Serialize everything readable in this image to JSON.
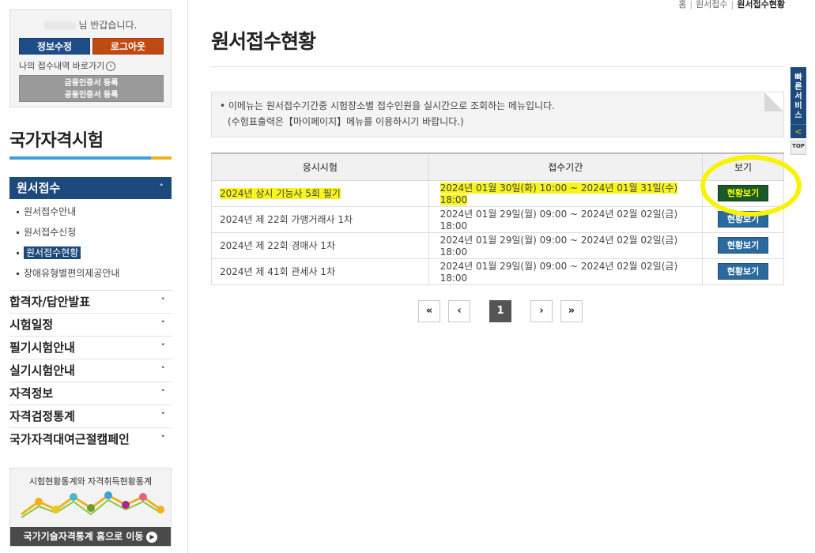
{
  "login": {
    "greeting_suffix": "님 반갑습니다.",
    "edit_button": "정보수정",
    "logout_button": "로그아웃",
    "my_link": "나의 접수내역 바로가기",
    "cert_line1": "금융인증서 등록",
    "cert_line2": "공동인증서 등록"
  },
  "sidebar": {
    "title": "국가자격시험",
    "active_menu": "원서접수",
    "submenu": [
      "원서접수안내",
      "원서접수신청",
      "원서접수현황",
      "장애유형별편의제공안내"
    ],
    "current_submenu_index": 2,
    "menus": [
      "합격자/답안발표",
      "시험일정",
      "필기시험안내",
      "실기시험안내",
      "자격정보",
      "자격검정통계",
      "국가자격대여근절캠페인"
    ]
  },
  "stats": {
    "title": "시험현황통계와 자격취득현황통계",
    "link": "국가기술자격통계 홈으로 이동"
  },
  "breadcrumb": [
    "홈",
    "원서접수",
    "원서접수현황"
  ],
  "page_title": "원서접수현황",
  "notice": {
    "line1": "• 이메뉴는 원서접수기간중 시험장소별 접수인원을 실시간으로 조회하는 메뉴입니다.",
    "line2": "(수험표출력은【마이페이지】메뉴를 이용하시기 바랍니다.)"
  },
  "table": {
    "headers": [
      "응시시험",
      "접수기간",
      "보기"
    ],
    "rows": [
      {
        "exam": "2024년 상시 기능사 5회 필기",
        "period": "2024년 01월 30일(화) 10:00 ~ 2024년 01월 31일(수) 18:00",
        "action": "현황보기"
      },
      {
        "exam": "2024년 제 22회 가맹거래사 1차",
        "period": "2024년 01월 29일(월) 09:00 ~ 2024년 02월 02일(금) 18:00",
        "action": "현황보기"
      },
      {
        "exam": "2024년 제 22회 경매사 1차",
        "period": "2024년 01월 29일(월) 09:00 ~ 2024년 02월 02일(금) 18:00",
        "action": "현황보기"
      },
      {
        "exam": "2024년 제 41회 관세사 1차",
        "period": "2024년 01월 29일(월) 09:00 ~ 2024년 02월 02일(금) 18:00",
        "action": "현황보기"
      }
    ]
  },
  "pagination": {
    "first": "«",
    "prev": "‹",
    "current": "1",
    "next": "›",
    "last": "»"
  },
  "quick": {
    "label": "빠른서비스",
    "arrow": "<",
    "top": "TOP"
  },
  "colors": {
    "highlight": "#f7f51c",
    "navy": "#1d4a7c",
    "accent_orange": "#c04a12"
  }
}
